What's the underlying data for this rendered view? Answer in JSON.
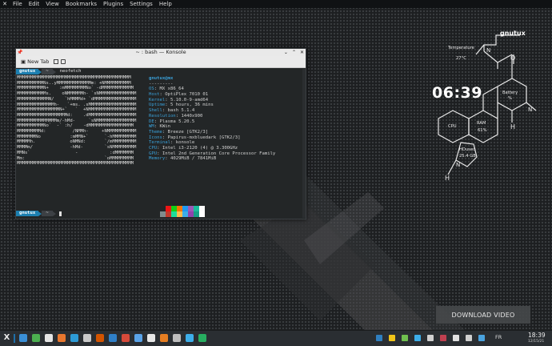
{
  "menubar": {
    "items": [
      "File",
      "Edit",
      "View",
      "Bookmarks",
      "Plugins",
      "Settings",
      "Help"
    ]
  },
  "konsole": {
    "title": "~ : bash — Konsole",
    "toolbar": {
      "new_tab": "New Tab"
    },
    "prompt_user": "gnutux",
    "prompt_dir": "~",
    "command": "neofetch",
    "ascii_art": [
      "MMMMMMMMMMMMMMMMMMMMMMMMMMMMMMMMMMMMMMMMMMM",
      "MMMMMMMMMMNs..yMMMMMMMMMMMMMm: +NMMMMMMMMMM",
      "MMMMMMMMMMN+    :mMMMMMMMMNo` -dMMMMMMMMMMMM",
      "MMMMMMMMMMMs.    oNMMMMMMh- `sNMMMMMMMMMMMMMM",
      "MMMMMMMMMMMMN/    `hMMMMd+ `dMMMMMMMMMMMMMMMM",
      "MMMMMMMMMMMMMMh-   `+ms. .sMMMMMMMMMMMMMMMMMM",
      "MMMMMMMMMMMMMMMMN+`   `  +NMMMMMMMMMMMMMMMMMM",
      "MMMMMMMMMMMMMMMMMMMd:    .dMMMMMMMMMMMMMMMMMM",
      "MMMMMMMMMMMMMMMm/-hMd-     `sNMMMMMMMMMMMMMMM",
      "MMMMMMMMMMNo`  -` :h/    -dMMMMMMMMMMMMMMMMM",
      "MMMMMMMMMd:          /NMMh-     +NMMMMMMMMMMM",
      "MMMMMMMNo           :mMMN+`      `-hMMMMMMMMM",
      "MMMMMh.             oNMNd:       `/mMMMMMMMMM",
      "MMMMm/              -hMd-        `sNMMMMMMMMM",
      "MMNs`                 -            :dMMMMMMM",
      "Mm:                              `oMMMMMMMMM",
      "MMMMMMMMMMMMMMMMMMMMMMMMMMMMMMMMMMMMMMMMMMMM"
    ],
    "info_header": "gnutux@mx",
    "info_separator": "---------",
    "info": [
      {
        "key": "OS",
        "value": "MX x86_64"
      },
      {
        "key": "Host",
        "value": "OptiPlex 7010 01"
      },
      {
        "key": "Kernel",
        "value": "5.10.0-9-amd64"
      },
      {
        "key": "Uptime",
        "value": "5 hours, 36 mins"
      },
      {
        "key": "Shell",
        "value": "bash 5.1.4"
      },
      {
        "key": "Resolution",
        "value": "1440x900"
      },
      {
        "key": "DE",
        "value": "Plasma 5.20.5"
      },
      {
        "key": "WM",
        "value": "KWin"
      },
      {
        "key": "Theme",
        "value": "Breeze [GTK2/3]"
      },
      {
        "key": "Icons",
        "value": "Papirus-mxbluedark [GTK2/3]"
      },
      {
        "key": "Terminal",
        "value": "konsole"
      },
      {
        "key": "CPU",
        "value": "Intel i3-2120 (4) @ 3.300GHz"
      },
      {
        "key": "GPU",
        "value": "Intel 2nd Generation Core Processor Family"
      },
      {
        "key": "Memory",
        "value": "4029MiB / 7841MiB"
      }
    ],
    "palette_top": [
      "#232627",
      "#ed1515",
      "#11d116",
      "#f67400",
      "#1d99f3",
      "#9b59b6",
      "#1abc9c",
      "#fcfcfc"
    ],
    "palette_bottom": [
      "#7f8c8d",
      "#c0392b",
      "#1cdc9a",
      "#fdbc4b",
      "#3daee9",
      "#8e44ad",
      "#16a085",
      "#ffffff"
    ],
    "bottom_prompt_user": "gnutux",
    "bottom_prompt_dir": "~"
  },
  "conky": {
    "username": "gnutux",
    "temperature_label": "Temperature",
    "temperature_value": "27°C",
    "clock": "06:39",
    "battery_label": "Battery",
    "battery_value": "%",
    "cpu_label": "CPU",
    "ram_label": "RAM",
    "ram_value": "61%",
    "hdd_label": "HDused",
    "hdd_value": "25.4 GB",
    "atom_n1": "N",
    "atom_h1": "H",
    "atom_n2": "N",
    "atom_h2": "H"
  },
  "overlay": {
    "download_video": "DOWNLOAD VIDEO"
  },
  "taskbar": {
    "language": "FR",
    "time": "18:39",
    "date": "12/15/21",
    "icon_colors": [
      "#3a8fd6",
      "#4caf50",
      "#e5e5e5",
      "#e8772e",
      "#2d9bd6",
      "#c9c9c9",
      "#d35400",
      "#2f80c8",
      "#d64a3a",
      "#5aa3e8",
      "#e7e7e7",
      "#e67e22",
      "#bdbdbd",
      "#3daee9",
      "#27ae60"
    ],
    "tray_colors": [
      "#2f7fc0",
      "#f0c419",
      "#6fbf4f",
      "#3daee9",
      "#d0d0d0",
      "#c04050",
      "#e0e0e0",
      "#d0d0d0",
      "#4aa3df"
    ]
  }
}
